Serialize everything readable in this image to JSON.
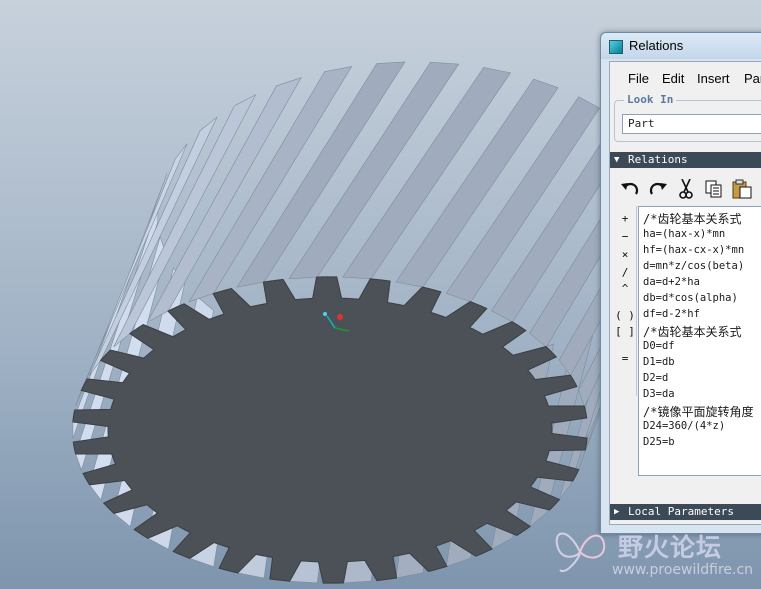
{
  "window": {
    "title": "Relations"
  },
  "menu": [
    "File",
    "Edit",
    "Insert",
    "Par"
  ],
  "look_in": {
    "label": "Look In",
    "value": "Part"
  },
  "sections": {
    "relations": "Relations",
    "local_parameters": "Local Parameters"
  },
  "toolbar_icons": [
    "undo-icon",
    "redo-icon",
    "cut-icon",
    "copy-icon",
    "paste-icon"
  ],
  "operators": [
    "+",
    "−",
    "×",
    "/",
    "^",
    "( )",
    "[ ]",
    "="
  ],
  "relations_lines": [
    "/*齿轮基本关系式",
    "ha=(hax-x)*mn",
    "hf=(hax-cx-x)*mn",
    "d=mn*z/cos(beta)",
    "da=d+2*ha",
    "db=d*cos(alpha)",
    "df=d-2*hf",
    "/*齿轮基本关系式",
    "D0=df",
    "D1=db",
    "D2=d",
    "D3=da",
    "/*镜像平面旋转角度",
    "D24=360/(4*z)",
    "D25=b"
  ],
  "watermark": {
    "brand": "野火论坛",
    "url": "www.proewildfire.cn"
  },
  "colors": {
    "background_top": "#c7d1dc",
    "background_bottom": "#7e95ad",
    "gear_face": "#4b5157",
    "gear_teeth": "#b9c7d6",
    "section_bar": "#3c4957"
  }
}
